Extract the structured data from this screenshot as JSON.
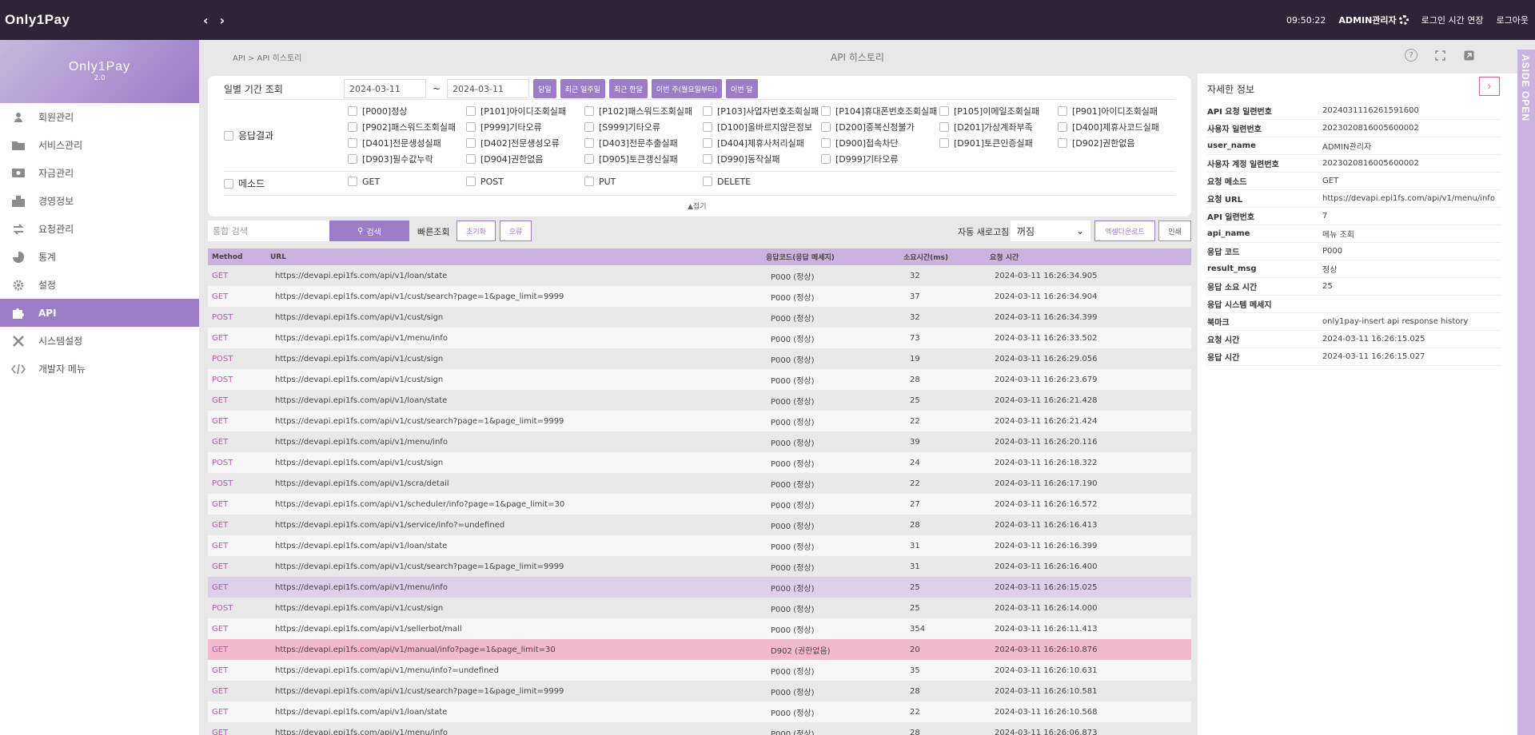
{
  "topbar": {
    "logo": "Only1Pay",
    "clock": "09:50:22",
    "admin": "ADMIN관리자",
    "extend": "로그인 시간 연장",
    "logout": "로그아웃"
  },
  "brand": {
    "name": "Only1Pay",
    "version": "2.0"
  },
  "menu": [
    {
      "label": "회원관리",
      "icon": "user-icon"
    },
    {
      "label": "서비스관리",
      "icon": "folder-icon"
    },
    {
      "label": "자금관리",
      "icon": "money-icon"
    },
    {
      "label": "경영정보",
      "icon": "building-icon"
    },
    {
      "label": "요청관리",
      "icon": "exchange-icon"
    },
    {
      "label": "통계",
      "icon": "pie-chart-icon"
    },
    {
      "label": "설정",
      "icon": "gear-icon"
    },
    {
      "label": "API",
      "icon": "puzzle-icon"
    },
    {
      "label": "시스템설정",
      "icon": "tools-icon"
    },
    {
      "label": "개발자 메뉴",
      "icon": "code-icon"
    }
  ],
  "breadcrumb": "API > API 히스토리",
  "page_title": "API 히스토리",
  "filter": {
    "date_label": "일별 기간 조회",
    "date_from": "2024-03-11",
    "date_to": "2024-03-11",
    "tilde": "~",
    "period_buttons": [
      "당일",
      "최근 일주일",
      "최근 한달",
      "이번 주(월요일부터)",
      "이번 달"
    ],
    "result_label": "응답결과",
    "codes": [
      "[P000]정상",
      "[P101]아이디조회실패",
      "[P102]패스워드조회실패",
      "[P103]사업자번호조회실패",
      "[P104]휴대폰번호조회실패",
      "[P105]이메일조회실패",
      "[P901]아이디조회실패",
      "[P902]패스워드조회실패",
      "[P999]기타오류",
      "[S999]기타오류",
      "[D100]올바르지않은정보",
      "[D200]중복신청불가",
      "[D201]가상계좌부족",
      "[D400]제휴사코드실패",
      "[D401]전문생성실패",
      "[D402]전문생성오류",
      "[D403]전문추출실패",
      "[D404]제휴사처리실패",
      "[D900]접속차단",
      "[D901]토큰인증실패",
      "[D902]권한없음",
      "[D903]필수값누락",
      "[D904]권한없음",
      "[D905]토큰갱신실패",
      "[D990]동작실패",
      "[D999]기타오류"
    ],
    "method_label": "메소드",
    "methods": [
      "GET",
      "POST",
      "PUT",
      "DELETE"
    ],
    "fold": "▲접기"
  },
  "search": {
    "placeholder": "통합 검색",
    "button": "검색",
    "quick_label": "빠른조회",
    "reset": "초기화",
    "error": "오류",
    "auto_label": "자동 새로고침",
    "auto_value": "꺼짐",
    "excel": "엑셀다운로드",
    "print": "인쇄"
  },
  "table": {
    "headers": [
      "Method",
      "URL",
      "응답코드(응답 메세지)",
      "소요시간(ms)",
      "요청 시간"
    ],
    "rows": [
      {
        "method": "GET",
        "url": "https://devapi.epi1fs.com/api/v1/loan/state",
        "code": "P000 (정상)",
        "ms": "32",
        "time": "2024-03-11 16:26:34.905"
      },
      {
        "method": "GET",
        "url": "https://devapi.epi1fs.com/api/v1/cust/search?page=1&page_limit=9999",
        "code": "P000 (정상)",
        "ms": "37",
        "time": "2024-03-11 16:26:34.904"
      },
      {
        "method": "POST",
        "url": "https://devapi.epi1fs.com/api/v1/cust/sign",
        "code": "P000 (정상)",
        "ms": "32",
        "time": "2024-03-11 16:26:34.399"
      },
      {
        "method": "GET",
        "url": "https://devapi.epi1fs.com/api/v1/menu/info",
        "code": "P000 (정상)",
        "ms": "73",
        "time": "2024-03-11 16:26:33.502"
      },
      {
        "method": "POST",
        "url": "https://devapi.epi1fs.com/api/v1/cust/sign",
        "code": "P000 (정상)",
        "ms": "19",
        "time": "2024-03-11 16:26:29.056"
      },
      {
        "method": "POST",
        "url": "https://devapi.epi1fs.com/api/v1/cust/sign",
        "code": "P000 (정상)",
        "ms": "28",
        "time": "2024-03-11 16:26:23.679"
      },
      {
        "method": "GET",
        "url": "https://devapi.epi1fs.com/api/v1/loan/state",
        "code": "P000 (정상)",
        "ms": "25",
        "time": "2024-03-11 16:26:21.428"
      },
      {
        "method": "GET",
        "url": "https://devapi.epi1fs.com/api/v1/cust/search?page=1&page_limit=9999",
        "code": "P000 (정상)",
        "ms": "22",
        "time": "2024-03-11 16:26:21.424"
      },
      {
        "method": "GET",
        "url": "https://devapi.epi1fs.com/api/v1/menu/info",
        "code": "P000 (정상)",
        "ms": "39",
        "time": "2024-03-11 16:26:20.116"
      },
      {
        "method": "POST",
        "url": "https://devapi.epi1fs.com/api/v1/cust/sign",
        "code": "P000 (정상)",
        "ms": "24",
        "time": "2024-03-11 16:26:18.322"
      },
      {
        "method": "POST",
        "url": "https://devapi.epi1fs.com/api/v1/scra/detail",
        "code": "P000 (정상)",
        "ms": "22",
        "time": "2024-03-11 16:26:17.190"
      },
      {
        "method": "GET",
        "url": "https://devapi.epi1fs.com/api/v1/scheduler/info?page=1&page_limit=30",
        "code": "P000 (정상)",
        "ms": "27",
        "time": "2024-03-11 16:26:16.572"
      },
      {
        "method": "GET",
        "url": "https://devapi.epi1fs.com/api/v1/service/info?=undefined",
        "code": "P000 (정상)",
        "ms": "28",
        "time": "2024-03-11 16:26:16.413"
      },
      {
        "method": "GET",
        "url": "https://devapi.epi1fs.com/api/v1/loan/state",
        "code": "P000 (정상)",
        "ms": "31",
        "time": "2024-03-11 16:26:16.399"
      },
      {
        "method": "GET",
        "url": "https://devapi.epi1fs.com/api/v1/cust/search?page=1&page_limit=9999",
        "code": "P000 (정상)",
        "ms": "31",
        "time": "2024-03-11 16:26:16.400"
      },
      {
        "method": "GET",
        "url": "https://devapi.epi1fs.com/api/v1/menu/info",
        "code": "P000 (정상)",
        "ms": "25",
        "time": "2024-03-11 16:26:15.025",
        "state": "selected"
      },
      {
        "method": "POST",
        "url": "https://devapi.epi1fs.com/api/v1/cust/sign",
        "code": "P000 (정상)",
        "ms": "25",
        "time": "2024-03-11 16:26:14.000"
      },
      {
        "method": "GET",
        "url": "https://devapi.epi1fs.com/api/v1/sellerbot/mall",
        "code": "P000 (정상)",
        "ms": "354",
        "time": "2024-03-11 16:26:11.413"
      },
      {
        "method": "GET",
        "url": "https://devapi.epi1fs.com/api/v1/manual/info?page=1&page_limit=30",
        "code": "D902 (권한없음)",
        "ms": "20",
        "time": "2024-03-11 16:26:10.876",
        "state": "error"
      },
      {
        "method": "GET",
        "url": "https://devapi.epi1fs.com/api/v1/menu/info?=undefined",
        "code": "P000 (정상)",
        "ms": "35",
        "time": "2024-03-11 16:26:10.631"
      },
      {
        "method": "GET",
        "url": "https://devapi.epi1fs.com/api/v1/cust/search?page=1&page_limit=9999",
        "code": "P000 (정상)",
        "ms": "28",
        "time": "2024-03-11 16:26:10.581"
      },
      {
        "method": "GET",
        "url": "https://devapi.epi1fs.com/api/v1/loan/state",
        "code": "P000 (정상)",
        "ms": "22",
        "time": "2024-03-11 16:26:10.568"
      },
      {
        "method": "GET",
        "url": "https://devapi.epi1fs.com/api/v1/menu/info",
        "code": "P000 (정상)",
        "ms": "28",
        "time": "2024-03-11 16:26:06.873"
      }
    ]
  },
  "aside": {
    "title": "자세한 정보",
    "close": "›",
    "details": [
      {
        "key": "API 요청 일련번호",
        "value": "2024031116261591600"
      },
      {
        "key": "사용자 일련번호",
        "value": "2023020816005600002"
      },
      {
        "key": "user_name",
        "value": "ADMIN관리자"
      },
      {
        "key": "사용자 계정 일련번호",
        "value": "2023020816005600002"
      },
      {
        "key": "요청 메소드",
        "value": "GET"
      },
      {
        "key": "요청 URL",
        "value": "https://devapi.epi1fs.com/api/v1/menu/info"
      },
      {
        "key": "API 일련번호",
        "value": "7"
      },
      {
        "key": "api_name",
        "value": "메뉴 조회"
      },
      {
        "key": "응답 코드",
        "value": "P000"
      },
      {
        "key": "result_msg",
        "value": "정상"
      },
      {
        "key": "응답 소요 시간",
        "value": "25"
      },
      {
        "key": "응답 시스템 메세지",
        "value": ""
      },
      {
        "key": "북마크",
        "value": "only1pay-insert api response history"
      },
      {
        "key": "요청 시간",
        "value": "2024-03-11 16:26:15.025"
      },
      {
        "key": "응답 시간",
        "value": "2024-03-11 16:26:15.027"
      }
    ],
    "open_label": "ASIDE OPEN"
  },
  "colors": {
    "accent": "#9b7cc7",
    "topbar": "#2d2438",
    "error_row": "#f3b9cd",
    "selected_row": "#dcd0ea"
  }
}
